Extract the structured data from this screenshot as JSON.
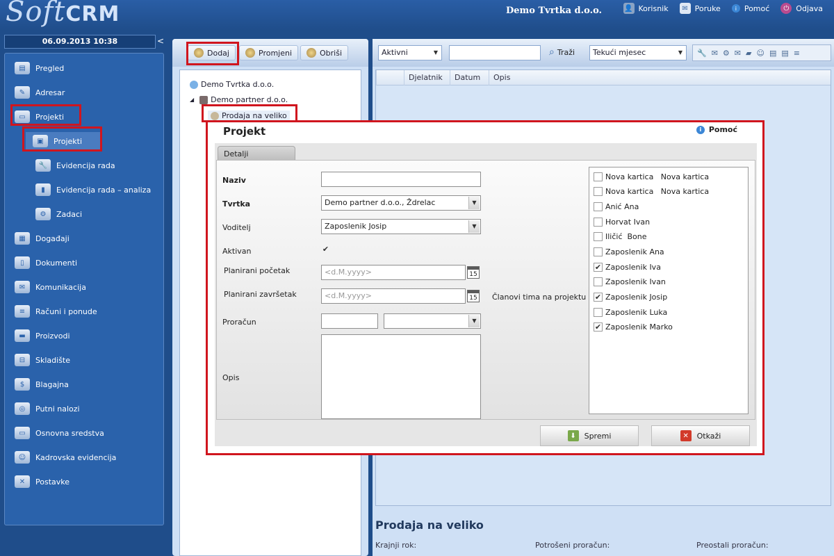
{
  "app": {
    "logo_main": "Soft",
    "logo_crm": "CRM",
    "company": "Demo Tvrtka d.o.o."
  },
  "toplinks": [
    {
      "label": "Korisnik",
      "icon": "user-icon"
    },
    {
      "label": "Poruke",
      "icon": "message-icon"
    },
    {
      "label": "Pomoć",
      "icon": "info-icon"
    },
    {
      "label": "Odjava",
      "icon": "power-icon"
    }
  ],
  "sidebar": {
    "datetime": "06.09.2013 10:38",
    "collapse": "<",
    "items": [
      {
        "label": "Pregled"
      },
      {
        "label": "Adresar"
      },
      {
        "label": "Projekti"
      },
      {
        "label": "Projekti"
      },
      {
        "label": "Evidencija rada"
      },
      {
        "label": "Evidencija rada – analiza"
      },
      {
        "label": "Zadaci"
      },
      {
        "label": "Događaji"
      },
      {
        "label": "Dokumenti"
      },
      {
        "label": "Komunikacija"
      },
      {
        "label": "Računi i ponude"
      },
      {
        "label": "Proizvodi"
      },
      {
        "label": "Skladište"
      },
      {
        "label": "Blagajna"
      },
      {
        "label": "Putni nalozi"
      },
      {
        "label": "Osnovna sredstva"
      },
      {
        "label": "Kadrovska evidencija"
      },
      {
        "label": "Postavke"
      }
    ]
  },
  "toolbar": {
    "add": "Dodaj",
    "edit": "Promjeni",
    "delete": "Obriši"
  },
  "tree": [
    {
      "label": "Demo Tvrtka d.o.o."
    },
    {
      "label": "Demo partner d.o.o."
    },
    {
      "label": "Prodaja na veliko"
    }
  ],
  "right": {
    "status_filter": "Aktivni",
    "search_value": "",
    "search_button": "Traži",
    "period": "Tekući mjesec",
    "columns": [
      "Djelatnik",
      "Datum",
      "Opis"
    ],
    "project_title": "Prodaja na veliko",
    "deadline_label": "Krajnji rok:",
    "spent_label": "Potrošeni proračun:",
    "remaining_label": "Preostali proračun:"
  },
  "dialog": {
    "title": "Projekt",
    "help": "Pomoć",
    "tab": "Detalji",
    "name_label": "Naziv",
    "name_value": "",
    "company_label": "Tvrtka",
    "company_value": "Demo partner d.o.o., Ždrelac",
    "manager_label": "Voditelj",
    "manager_value": "Zaposlenik Josip",
    "active_label": "Aktivan",
    "active_checked": true,
    "start_label": "Planirani početak",
    "start_placeholder": "<d.M.yyyy>",
    "end_label": "Planirani završetak",
    "end_placeholder": "<d.M.yyyy>",
    "calendar_day": "15",
    "budget_label": "Proračun",
    "budget_value": "",
    "currency_value": "",
    "description_label": "Opis",
    "description_value": "",
    "members_label": "Članovi tima na projektu",
    "members": [
      {
        "name": "Nova kartica   Nova kartica",
        "checked": false
      },
      {
        "name": "Nova kartica   Nova kartica",
        "checked": false
      },
      {
        "name": "Anić Ana",
        "checked": false
      },
      {
        "name": "Horvat Ivan",
        "checked": false
      },
      {
        "name": "Iličić  Bone",
        "checked": false
      },
      {
        "name": "Zaposlenik Ana",
        "checked": false
      },
      {
        "name": "Zaposlenik Iva",
        "checked": true
      },
      {
        "name": "Zaposlenik Ivan",
        "checked": false
      },
      {
        "name": "Zaposlenik Josip",
        "checked": true
      },
      {
        "name": "Zaposlenik Luka",
        "checked": false
      },
      {
        "name": "Zaposlenik Marko",
        "checked": true
      }
    ],
    "save": "Spremi",
    "cancel": "Otkaži"
  },
  "colors": {
    "highlight": "#d0151e",
    "nav_bg": "#1f4d8a",
    "panel_bg": "#cfe0f5"
  }
}
